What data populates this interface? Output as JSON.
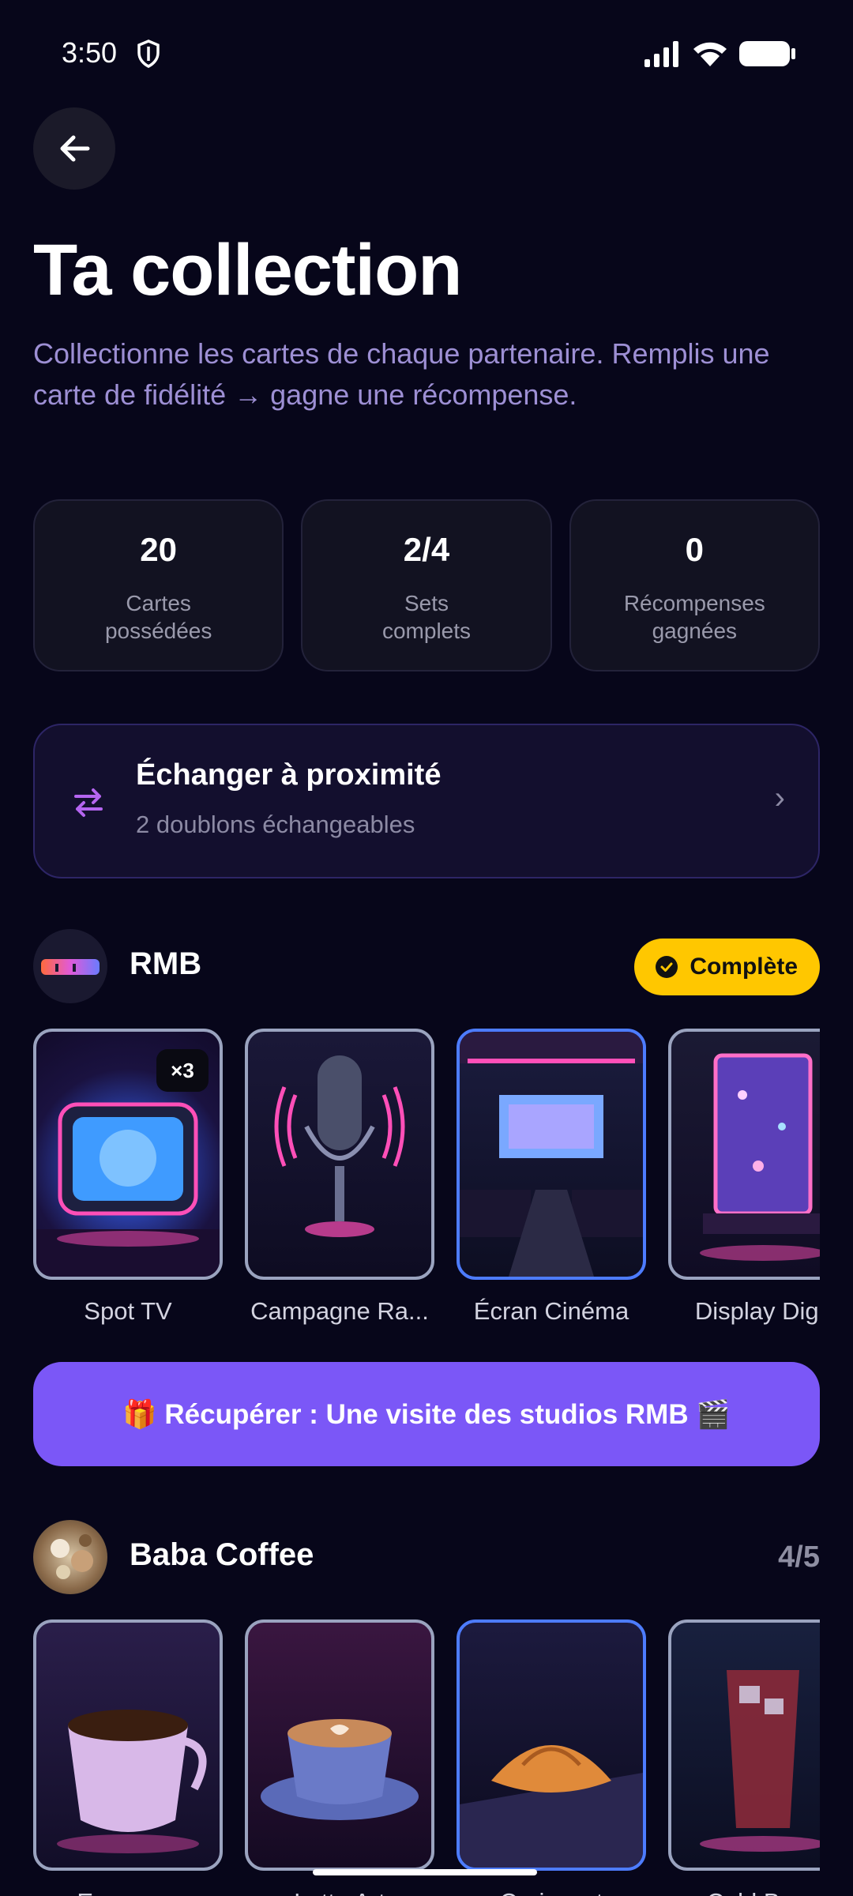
{
  "status": {
    "time": "3:50"
  },
  "header": {
    "title": "Ta collection",
    "subtitle": "Collectionne les cartes de chaque partenaire. Remplis une carte de fidélité → gagne une récompense."
  },
  "stats": [
    {
      "value": "20",
      "label": "Cartes\npossédées"
    },
    {
      "value": "2/4",
      "label": "Sets\ncomplets"
    },
    {
      "value": "0",
      "label": "Récompenses\ngagnées"
    }
  ],
  "exchange": {
    "title": "Échanger à proximité",
    "subtitle": "2 doublons échangeables",
    "chevron": "›"
  },
  "partners": [
    {
      "name": "RMB",
      "status": "Complète",
      "cards": [
        {
          "label": "Spot TV",
          "duplicates": "×3"
        },
        {
          "label": "Campagne Ra..."
        },
        {
          "label": "Écran Cinéma"
        },
        {
          "label": "Display Digit"
        }
      ],
      "reward_label": "🎁 Récupérer : Une visite des studios RMB 🎬"
    },
    {
      "name": "Baba Coffee",
      "progress": "4/5",
      "cards": [
        {
          "label": "Espresso"
        },
        {
          "label": "Latte Art"
        },
        {
          "label": "Croissant"
        },
        {
          "label": "Cold Brew"
        }
      ]
    }
  ],
  "colors": {
    "background": "#07061a",
    "accent": "#7b57f7",
    "complete_badge": "#ffc700",
    "subtitle": "#9d8fd4"
  }
}
